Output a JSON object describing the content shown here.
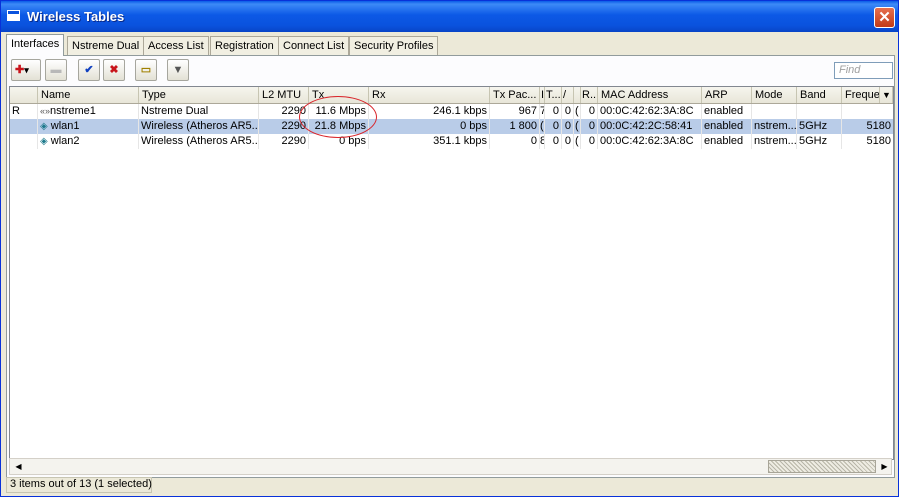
{
  "window": {
    "title": "Wireless Tables",
    "close_glyph": "✕"
  },
  "tabs": [
    {
      "label": "Interfaces",
      "active": true
    },
    {
      "label": "Nstreme Dual"
    },
    {
      "label": "Access List"
    },
    {
      "label": "Registration"
    },
    {
      "label": "Connect List"
    },
    {
      "label": "Security Profiles"
    }
  ],
  "toolbar": {
    "add_glyph": "✚",
    "add_arrow": "▾",
    "remove_glyph": "▬",
    "enable_glyph": "✔",
    "disable_glyph": "✖",
    "comment_glyph": "▭",
    "filter_glyph": "▼",
    "find_placeholder": "Find"
  },
  "columns": [
    "",
    "Name",
    "Type",
    "L2 MTU",
    "Tx",
    "Rx",
    "Tx Pac...",
    "I",
    "T...",
    "/",
    "",
    "R...",
    "MAC Address",
    "ARP",
    "Mode",
    "Band",
    "Freque",
    "▼"
  ],
  "rows": [
    {
      "flag": "R",
      "name": "nstreme1",
      "icon": "nstreme-icon",
      "type": "Nstreme Dual",
      "mtu": "2290",
      "tx": "11.6 Mbps",
      "rx": "246.1 kbps",
      "txpac": "967",
      "c1": "7",
      "c2": "0",
      "c3": "0",
      "c4": "(",
      "c5": "0",
      "mac": "00:0C:42:62:3A:8C",
      "arp": "enabled",
      "mode": "",
      "band": "",
      "freq": ""
    },
    {
      "flag": "",
      "name": "wlan1",
      "icon": "wireless-icon",
      "type": "Wireless (Atheros AR5...",
      "mtu": "2290",
      "tx": "21.8 Mbps",
      "rx": "0 bps",
      "txpac": "1 800",
      "c1": "(",
      "c2": "0",
      "c3": "0",
      "c4": "(",
      "c5": "0",
      "mac": "00:0C:42:2C:58:41",
      "arp": "enabled",
      "mode": "nstrem...",
      "band": "5GHz",
      "freq": "5180",
      "selected": true
    },
    {
      "flag": "",
      "name": "wlan2",
      "icon": "wireless-icon",
      "type": "Wireless (Atheros AR5...",
      "mtu": "2290",
      "tx": "0 bps",
      "rx": "351.1 kbps",
      "txpac": "0",
      "c1": "8",
      "c2": "0",
      "c3": "0",
      "c4": "(",
      "c5": "0",
      "mac": "00:0C:42:62:3A:8C",
      "arp": "enabled",
      "mode": "nstrem...",
      "band": "5GHz",
      "freq": "5180"
    }
  ],
  "scrollbar": {
    "left_arrow": "◀",
    "right_arrow": "▶"
  },
  "status": {
    "text": "3 items out of 13 (1 selected)"
  },
  "colors": {
    "title_blue": "#0a52dd",
    "selection": "#b9cce8",
    "annotation_red": "#d9252b"
  }
}
